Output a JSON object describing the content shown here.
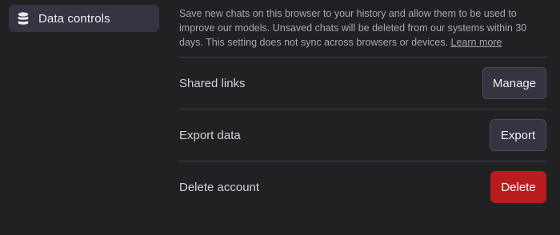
{
  "sidebar": {
    "active_item": {
      "label": "Data controls",
      "icon": "database-icon"
    }
  },
  "chat_history": {
    "description": "Save new chats on this browser to your history and allow them to be used to improve our models. Unsaved chats will be deleted from our systems within 30 days. This setting does not sync across browsers or devices.",
    "learn_more": "Learn more"
  },
  "rows": {
    "shared_links": {
      "label": "Shared links",
      "button": "Manage"
    },
    "export_data": {
      "label": "Export data",
      "button": "Export"
    },
    "delete_account": {
      "label": "Delete account",
      "button": "Delete"
    }
  },
  "colors": {
    "background": "#202123",
    "active_nav": "#343541",
    "danger": "#b91c1c"
  }
}
